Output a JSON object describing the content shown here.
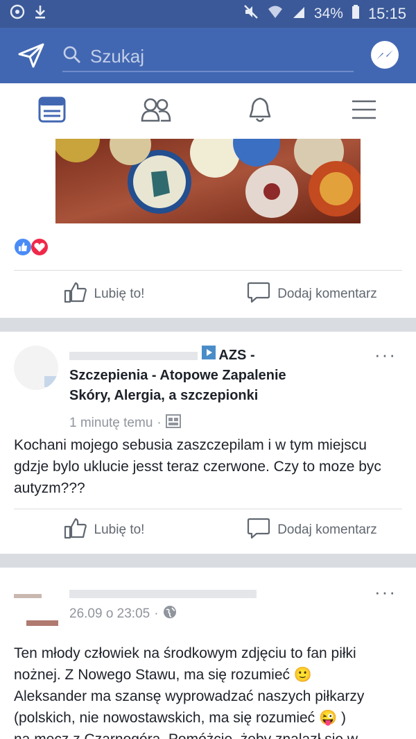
{
  "status_bar": {
    "battery": "34%",
    "time": "15:15"
  },
  "search": {
    "placeholder": "Szukaj"
  },
  "post1": {
    "like_label": "Lubię to!",
    "comment_label": "Dodaj komentarz"
  },
  "post2": {
    "group_title": "AZS -",
    "group_title_line2": "Szczepienia - Atopowe Zapalenie",
    "group_title_line3": "Skóry, Alergia, a szczepionki",
    "time": "1 minutę temu",
    "text": "Kochani mojego sebusia zaszczepilam i w tym miejscu gdzje bylo uklucie jesst teraz czerwone. Czy to moze byc autyzm???",
    "like_label": "Lubię to!",
    "comment_label": "Dodaj komentarz",
    "more": "···"
  },
  "post3": {
    "time": "26.09 o 23:05",
    "text_line1": "Ten młody człowiek na środkowym zdjęciu to fan piłki",
    "text_line2": "nożnej. Z Nowego Stawu, ma się rozumieć 🙂",
    "text_line3": "Aleksander ma szansę wyprowadzać naszych piłkarzy",
    "text_line4": "(polskich, nie nowostawskich, ma się rozumieć 😜 )",
    "text_line5": "na mecz z Czarnogórą. Pomóżcie, żeby znalazł się w",
    "more": "···"
  }
}
